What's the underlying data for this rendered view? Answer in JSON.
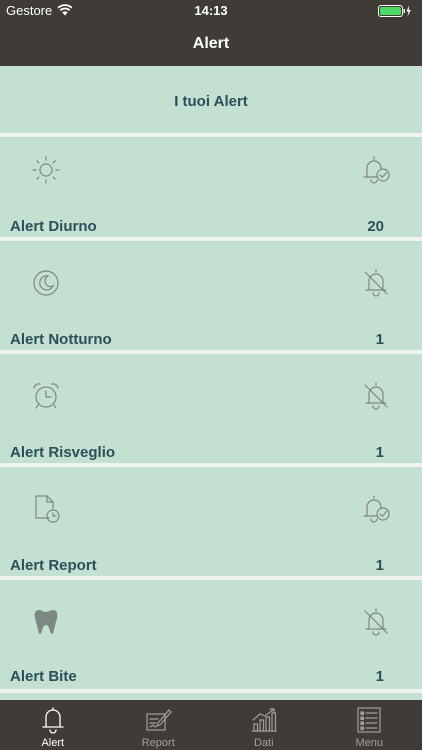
{
  "status": {
    "carrier": "Gestore",
    "time": "14:13"
  },
  "nav": {
    "title": "Alert"
  },
  "header": {
    "label": "I tuoi Alert"
  },
  "rows": [
    {
      "label": "Alert Diurno",
      "count": "20",
      "icon": "sun-icon",
      "bell": "bell-check-icon"
    },
    {
      "label": "Alert Notturno",
      "count": "1",
      "icon": "moon-icon",
      "bell": "bell-off-icon"
    },
    {
      "label": "Alert Risveglio",
      "count": "1",
      "icon": "alarm-clock-icon",
      "bell": "bell-off-icon"
    },
    {
      "label": "Alert Report",
      "count": "1",
      "icon": "document-clock-icon",
      "bell": "bell-check-icon"
    },
    {
      "label": "Alert Bite",
      "count": "1",
      "icon": "tooth-icon",
      "bell": "bell-off-icon"
    }
  ],
  "tabs": [
    {
      "label": "Alert",
      "icon": "bell-icon",
      "active": true
    },
    {
      "label": "Report",
      "icon": "report-icon",
      "active": false
    },
    {
      "label": "Dati",
      "icon": "chart-icon",
      "active": false
    },
    {
      "label": "Menu",
      "icon": "list-icon",
      "active": false
    }
  ],
  "colors": {
    "bar": "#3f3b36",
    "row": "#c3e0d0",
    "text": "#2c4f5a",
    "battery": "#4cd964"
  }
}
